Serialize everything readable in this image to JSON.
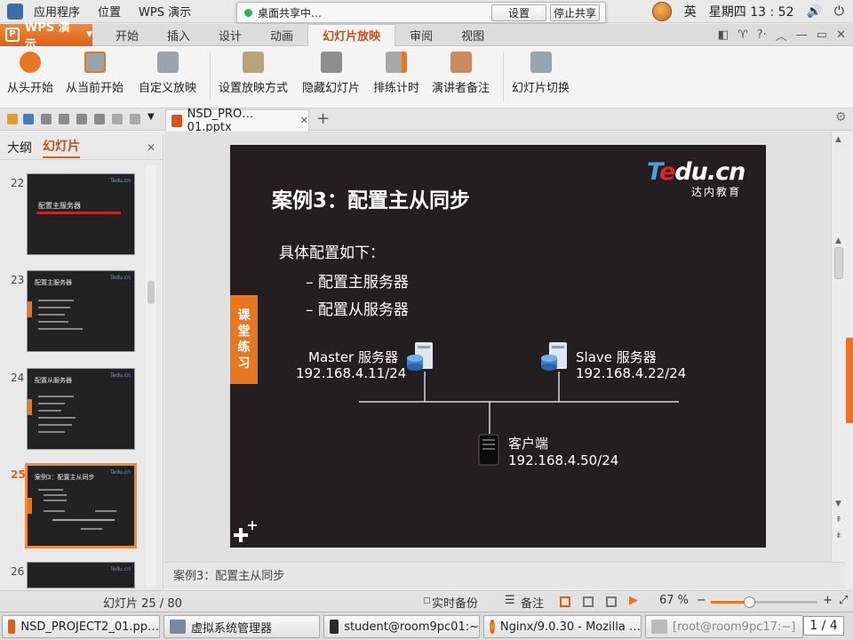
{
  "sysbar": {
    "menu": [
      "应用程序",
      "位置",
      "WPS 演示"
    ],
    "share_status": "桌面共享中…",
    "share_settings": "设置",
    "share_stop": "停止共享",
    "ime": "英",
    "datetime": "星期四 13 : 52"
  },
  "app": {
    "wps_label": "WPS 演示",
    "tabs": [
      "开始",
      "插入",
      "设计",
      "动画",
      "幻灯片放映",
      "审阅",
      "视图"
    ],
    "active_tab": "幻灯片放映"
  },
  "ribbon": {
    "buttons": [
      "从头开始",
      "从当前开始",
      "自定义放映",
      "设置放映方式",
      "隐藏幻灯片",
      "排练计时",
      "演讲者备注",
      "幻灯片切换"
    ]
  },
  "doc": {
    "tab_name": "NSD_PRO…01.pptx"
  },
  "leftpanel": {
    "tabs": [
      "大纲",
      "幻灯片"
    ],
    "active": "幻灯片",
    "thumbs": [
      {
        "num": "22",
        "title": "配置主服务器"
      },
      {
        "num": "23",
        "title": "配置主服务器"
      },
      {
        "num": "24",
        "title": "配置从服务器"
      },
      {
        "num": "25",
        "title": "案例3：配置主从同步"
      },
      {
        "num": "26",
        "title": ""
      }
    ]
  },
  "slide": {
    "title": "案例3：配置主从同步",
    "logo_main": "Tedu.cn",
    "logo_sub": "达内教育",
    "intro": "具体配置如下：",
    "bullets": [
      "–  配置主服务器",
      "–  配置从服务器"
    ],
    "tag": [
      "课",
      "堂",
      "练",
      "习"
    ],
    "master_name": "Master 服务器",
    "master_ip": "192.168.4.11/24",
    "slave_name": "Slave 服务器",
    "slave_ip": "192.168.4.22/24",
    "client_name": "客户端",
    "client_ip": "192.168.4.50/24"
  },
  "notes": "案例3：配置主从同步",
  "status": {
    "slide_label": "幻灯片 25 / 80",
    "backup": "实时备份",
    "notes_btn": "备注",
    "zoom": "67 %",
    "zoom_level": 0.36
  },
  "taskbar": {
    "items": [
      "NSD_PROJECT2_01.pp…",
      "虚拟系统管理器",
      "student@room9pc01:~",
      "Nginx/9.0.30 - Mozilla …",
      "[root@room9pc17:~]"
    ],
    "pager": "1 / 4"
  },
  "colors": {
    "accent": "#e87722",
    "slide_bg": "#231f20",
    "wps_orange": "#d9621a"
  }
}
